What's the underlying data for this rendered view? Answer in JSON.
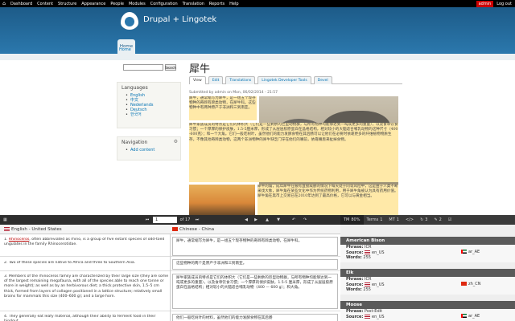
{
  "adminbar": {
    "items": [
      "Dashboard",
      "Content",
      "Structure",
      "Appearance",
      "People",
      "Modules",
      "Configuration",
      "Translation",
      "Reports",
      "Help"
    ],
    "user": "admin",
    "logout": "Log out"
  },
  "header": {
    "site_name": "Drupal + Lingotek",
    "home_tab": "Home",
    "breadcrumb": "Home"
  },
  "sidebar": {
    "search_button": "Search",
    "languages_title": "Languages",
    "languages": [
      "English",
      "中文",
      "Nederlands",
      "Deutsch",
      "한국어"
    ],
    "navigation_title": "Navigation",
    "nav_items": [
      "Add content"
    ]
  },
  "page": {
    "title": "犀牛",
    "tabs": [
      "View",
      "Edit",
      "Translations",
      "Lingotek Developer Tools",
      "Devel"
    ],
    "submitted": "Submitted by admin on Mon, 06/02/2014 - 21:57",
    "paragraph1": "犀牛，通常缩写为犀牛，是一组五个现存物种的奇蹄有蹄类动物，在犀牛科。这些物种中有两种原产于非洲和三到南亚。",
    "paragraph2": "犀牛家族成员的特点是它们的体积大（它们是一些剩余的巨型动物群，与所有物种均能够达到一吨或更多的重量），以及食草饮食习惯；一个厚厚的保护皮肤，1.5-5厘米厚，形成了从层层胶原蛋白在晶格结构，相对较小的大脑适合哺乳动物的这种尺寸（400-600克）；和一个大角。它们一般吃树叶，虽然他们的能力发酵食物在其后肠可以让他们在必要时依靠更多的纤维植物物质生存。不像其他奇蹄类动物，这两个非洲物种的犀牛缺乏门牙在他们的嘴前，依靠嘴唇来扯掉食物。",
    "paragraph3": "犀牛的角，成年犀牛在被有直接威胁的情况下每天处于同等风险中，这是由于人类不断采伐大象，犀牛角在某些文化中作为传统药物利用，用于犀牛角被认为具有药用价值。犀牛角在黑市上交易已在2010年达到了最高价格，它可以与黄金相当。"
  },
  "editor": {
    "pager_current": "1",
    "pager_total": "of 17",
    "source_lang": "English - United States",
    "target_lang": "Chinese - China",
    "segments": [
      {
        "source_term": "Rhinoceros",
        "source_rest": ", often abbreviated as rhino, is a group of five extant species of odd-toed ungulates in the family Rhinocerotidae.",
        "target": "犀牛，通常缩写为犀牛，是一组五个现存物种的奇蹄有蹄类动物，在犀牛科。"
      },
      {
        "source": "2. Two of these species are native to Africa and three to Southern Asia.",
        "target": "这些物种的两个是原产于非洲和三到南亚。"
      },
      {
        "source": "3. Members of the rhinoceros family are characterized by their large size (they are some of the largest remaining megafauna, with all of the species able to reach one tonne or more in weight); as well as by an herbivorous diet; a thick protective skin, 1.5–5 cm thick, formed from layers of collagen positioned in a lattice structure; relatively small brains for mammals this size (400–600 g); and a large horn.",
        "target": "犀牛家族成员的特点是它们的体积大（它们是一些剩余的巨型动物群，与所有物种均能够达到一吨或更多的重量），以及食草饮食习惯；一个厚厚的保护皮肤，1.5-5 厘米厚，形成了从层层胶原蛋白在晶格结构；相对较小的大脑适合哺乳动物（400 — 600 g）；和大角。"
      },
      {
        "source": "4. They generally eat leafy material, although their ability to ferment food in their hindgut",
        "target": "他们一般吃树叶的材料，虽然他们的能力发酵食物在其后肠"
      }
    ]
  },
  "tm_panel": {
    "tabs": [
      "TM",
      "Terms",
      "MT",
      "",
      "",
      ""
    ],
    "tm_label": "TM",
    "tm_count": "80%",
    "terms_label": "Terms",
    "terms_count": "1",
    "mt_label": "MT",
    "mt_count": "1",
    "count_a": "3",
    "count_b": "2",
    "entries": [
      {
        "title": "American Bison",
        "phrase": "ICR",
        "source": "en_US",
        "words": "255",
        "target": "ar_AE"
      },
      {
        "title": "Elk",
        "phrase": "ICR",
        "source": "en_US",
        "words": "255",
        "target": "zh_CN"
      },
      {
        "title": "Moose",
        "phrase": "Post-Edit",
        "source": "en_US",
        "words": "",
        "target": "ar_AE"
      }
    ],
    "phrase_label": "Phrase:",
    "source_label": "Source:",
    "words_label": "Words:"
  }
}
